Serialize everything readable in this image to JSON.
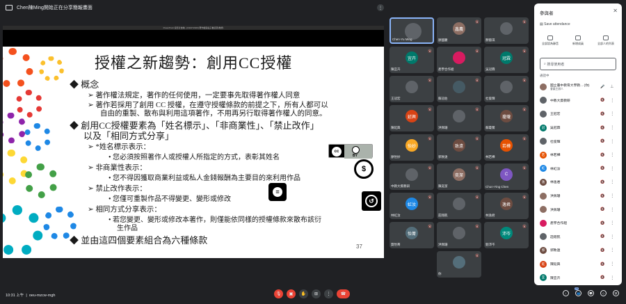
{
  "topbar": {
    "presenter_text": "Chen陳Ming開始正在分享簡報畫面"
  },
  "slide": {
    "chrome_title": "PowerPoint 投影片放映 - [ICEST2020] 著作權與電子書資源(教師)",
    "title": "授權之新趨勢：創用CC授權",
    "lines": [
      {
        "bullet": "◆",
        "text": "概念",
        "level": 1
      },
      {
        "bullet": "➢",
        "text": "著作權法規定，著作的任何使用，一定要事先取得著作權人同意",
        "level": 2
      },
      {
        "bullet": "➢",
        "text": "著作若採用了創用 CC 授權，在遵守授權條款的前提之下，所有人都可以",
        "level": 2
      },
      {
        "bullet": "",
        "text": "自由的重製、散布與利用這項著作，不用再另行取得著作權人的同意。",
        "level": 2
      },
      {
        "bullet": "◆",
        "text": "創用CC授權要素為「姓名標示」、「非商業性」、「禁止改作」",
        "level": 1
      },
      {
        "bullet": "",
        "text": "以及「相同方式分享」",
        "level": 1
      },
      {
        "bullet": "➢",
        "text": "*姓名標示表示：",
        "level": 2
      },
      {
        "bullet": "•",
        "text": "您必須按照著作人或授權人所指定的方式，表彰其姓名",
        "level": 3
      },
      {
        "bullet": "➢",
        "text": "非商業性表示：",
        "level": 2
      },
      {
        "bullet": "•",
        "text": "您不得因獲取商業利益或私人金錢報酬為主要目的來利用作品",
        "level": 3
      },
      {
        "bullet": "➢",
        "text": "禁止改作表示：",
        "level": 2
      },
      {
        "bullet": "•",
        "text": "您僅可重製作品不得變更、變形或修改",
        "level": 3
      },
      {
        "bullet": "➢",
        "text": "相同方式分享表示：",
        "level": 2
      },
      {
        "bullet": "•",
        "text": "若您變更、變形或修改本著作，則僅能依同樣的授權條款來散布該衍",
        "level": 3
      },
      {
        "bullet": "",
        "text": "生作品",
        "level": 3
      },
      {
        "bullet": "◆",
        "text": "並由這四個要素組合為六種條款",
        "level": 1
      }
    ],
    "page_number": "37",
    "icons": {
      "by": "cc-by",
      "nc": "non-commercial",
      "nd": "no-derivatives",
      "sa": "share-alike"
    },
    "cc_badge_text": "BY"
  },
  "tiles": [
    {
      "name": "Chen-Yu Ming",
      "initial": "",
      "color": "#5f6368"
    },
    {
      "name": "廖國慶",
      "initial": "鑫農",
      "color": "#8d6e63"
    },
    {
      "name": "顏裔琪",
      "initial": "",
      "color": "#5f6368"
    },
    {
      "name": "陳宜卉",
      "initial": "宜卉",
      "color": "#00796b"
    },
    {
      "name": "產學合作組",
      "initial": "",
      "color": "#d81b60"
    },
    {
      "name": "吳冠霖",
      "initial": "冠霖",
      "color": "#00796b"
    },
    {
      "name": "王冠宏",
      "initial": "",
      "color": "#5f6368"
    },
    {
      "name": "蘇冠伯",
      "initial": "",
      "color": "#455a64"
    },
    {
      "name": "杜俊輝",
      "initial": "",
      "color": "#5f6368"
    },
    {
      "name": "陳延興",
      "initial": "延興",
      "color": "#d84315"
    },
    {
      "name": "洪佩珊",
      "initial": "",
      "color": "#5f6368"
    },
    {
      "name": "蘇瓊鶯",
      "initial": "瓊瓏",
      "color": "#6d4c41"
    },
    {
      "name": "廖怡妙",
      "initial": "怡妙",
      "color": "#f9a825"
    },
    {
      "name": "郭致遠",
      "initial": "致遠",
      "color": "#6d4c41"
    },
    {
      "name": "林若樺",
      "initial": "若樺",
      "color": "#e65100"
    },
    {
      "name": "中教大資教研",
      "initial": "",
      "color": "#5f6368"
    },
    {
      "name": "陳奕潔",
      "initial": "奕潔",
      "color": "#8d6e63"
    },
    {
      "name": "Chun-Ying Chen",
      "initial": "C",
      "color": "#7e57c2"
    },
    {
      "name": "林虹汝",
      "initial": "虹汝",
      "color": "#1e88e5"
    },
    {
      "name": "莊翔凱",
      "initial": "",
      "color": "#5f6368"
    },
    {
      "name": "林逸君",
      "initial": "逸君",
      "color": "#6d4c41"
    },
    {
      "name": "賀怡菁",
      "initial": "怡菁",
      "color": "#546e7a"
    },
    {
      "name": "洪佩珊",
      "initial": "",
      "color": "#5f6368"
    },
    {
      "name": "劉沛岑",
      "initial": "沛岑",
      "color": "#00897b"
    },
    {
      "name": "你",
      "initial": "",
      "color": "#546e7a"
    }
  ],
  "panel": {
    "title": "參與者",
    "attendance": "Save attendance",
    "actions": [
      "全部設為靜音",
      "新增成員",
      "全部人的列表"
    ],
    "search_placeholder": "搜尋使用者",
    "section_label": "通話中",
    "participants": [
      {
        "name": "國立臺中教育大學教... (你)",
        "sub": "會議主辦人",
        "initial": "",
        "color": "#8d6e63"
      },
      {
        "name": "中教大資教研",
        "initial": "",
        "color": "#5f6368"
      },
      {
        "name": "王冠宏",
        "initial": "",
        "color": "#5f6368"
      },
      {
        "name": "吳冠霖",
        "initial": "冠",
        "color": "#00796b"
      },
      {
        "name": "杜俊輝",
        "initial": "",
        "color": "#5f6368"
      },
      {
        "name": "林若樺",
        "initial": "若",
        "color": "#e65100"
      },
      {
        "name": "林虹汝",
        "initial": "虹",
        "color": "#1e88e5"
      },
      {
        "name": "林逸君",
        "initial": "逸",
        "color": "#6d4c41"
      },
      {
        "name": "洪佩珊",
        "initial": "",
        "color": "#8d6e63"
      },
      {
        "name": "洪佩珊",
        "initial": "",
        "color": "#8d6e63"
      },
      {
        "name": "產學合作組",
        "initial": "",
        "color": "#d81b60"
      },
      {
        "name": "莊翔凱",
        "initial": "",
        "color": "#5f6368"
      },
      {
        "name": "郭致遠",
        "initial": "郭",
        "color": "#6d4c41"
      },
      {
        "name": "陳延興",
        "initial": "延",
        "color": "#d84315"
      },
      {
        "name": "陳宜卉",
        "initial": "宜",
        "color": "#00796b"
      }
    ]
  },
  "bottombar": {
    "time": "10:31 上午",
    "meeting_code": "oeu-mzcw-mgh",
    "participant_count": "25"
  }
}
